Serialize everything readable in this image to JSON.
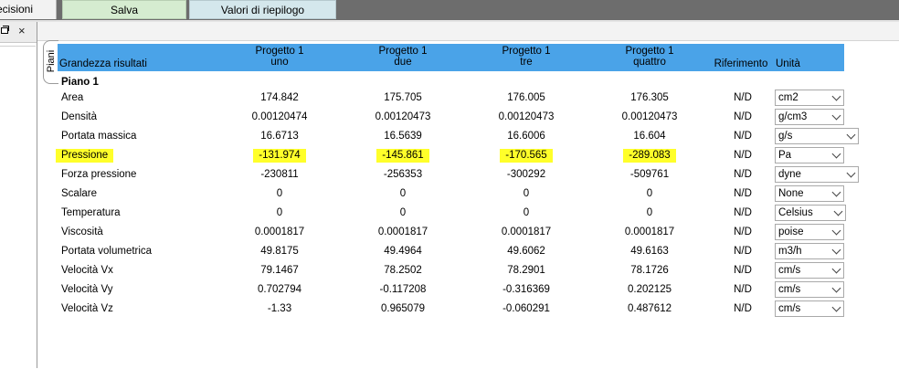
{
  "tabs": {
    "decisioni": "ecisioni",
    "salva": "Salva",
    "valori": "Valori di riepilogo"
  },
  "pane": {
    "close": "×"
  },
  "vertical_tab": {
    "label": "Piani"
  },
  "grid": {
    "header": {
      "label": "Grandezza risultati",
      "col1_line1": "Progetto 1",
      "col1_line2": "uno",
      "col2_line1": "Progetto 1",
      "col2_line2": "due",
      "col3_line1": "Progetto 1",
      "col3_line2": "tre",
      "col4_line1": "Progetto 1",
      "col4_line2": "quattro",
      "reference": "Riferimento",
      "unit": "Unità"
    },
    "section": "Piano 1",
    "rows": [
      {
        "label": "Area",
        "v1": "174.842",
        "v2": "175.705",
        "v3": "176.005",
        "v4": "176.305",
        "ref": "N/D",
        "unit": "cm2"
      },
      {
        "label": "Densità",
        "v1": "0.00120474",
        "v2": "0.00120473",
        "v3": "0.00120473",
        "v4": "0.00120473",
        "ref": "N/D",
        "unit": "g/cm3"
      },
      {
        "label": "Portata massica",
        "v1": "16.6713",
        "v2": "16.5639",
        "v3": "16.6006",
        "v4": "16.604",
        "ref": "N/D",
        "unit": "g/s"
      },
      {
        "label": "Pressione",
        "v1": "-131.974",
        "v2": "-145.861",
        "v3": "-170.565",
        "v4": "-289.083",
        "ref": "N/D",
        "unit": "Pa"
      },
      {
        "label": "Forza pressione",
        "v1": "-230811",
        "v2": "-256353",
        "v3": "-300292",
        "v4": "-509761",
        "ref": "N/D",
        "unit": "dyne"
      },
      {
        "label": "Scalare",
        "v1": "0",
        "v2": "0",
        "v3": "0",
        "v4": "0",
        "ref": "N/D",
        "unit": "None"
      },
      {
        "label": "Temperatura",
        "v1": "0",
        "v2": "0",
        "v3": "0",
        "v4": "0",
        "ref": "N/D",
        "unit": "Celsius"
      },
      {
        "label": "Viscosità",
        "v1": "0.0001817",
        "v2": "0.0001817",
        "v3": "0.0001817",
        "v4": "0.0001817",
        "ref": "N/D",
        "unit": "poise"
      },
      {
        "label": "Portata volumetrica",
        "v1": "49.8175",
        "v2": "49.4964",
        "v3": "49.6062",
        "v4": "49.6163",
        "ref": "N/D",
        "unit": "m3/h"
      },
      {
        "label": "Velocità Vx",
        "v1": "79.1467",
        "v2": "78.2502",
        "v3": "78.2901",
        "v4": "78.1726",
        "ref": "N/D",
        "unit": "cm/s"
      },
      {
        "label": "Velocità Vy",
        "v1": "0.702794",
        "v2": "-0.117208",
        "v3": "-0.316369",
        "v4": "0.202125",
        "ref": "N/D",
        "unit": "cm/s"
      },
      {
        "label": "Velocità Vz",
        "v1": "-1.33",
        "v2": "0.965079",
        "v3": "-0.060291",
        "v4": "0.487612",
        "ref": "N/D",
        "unit": "cm/s"
      }
    ]
  },
  "colors": {
    "header_bg": "#4aa3e8",
    "highlight": "#ffff2a",
    "salva_tab": "#d5ecd0",
    "valori_tab": "#d4e7ec"
  }
}
